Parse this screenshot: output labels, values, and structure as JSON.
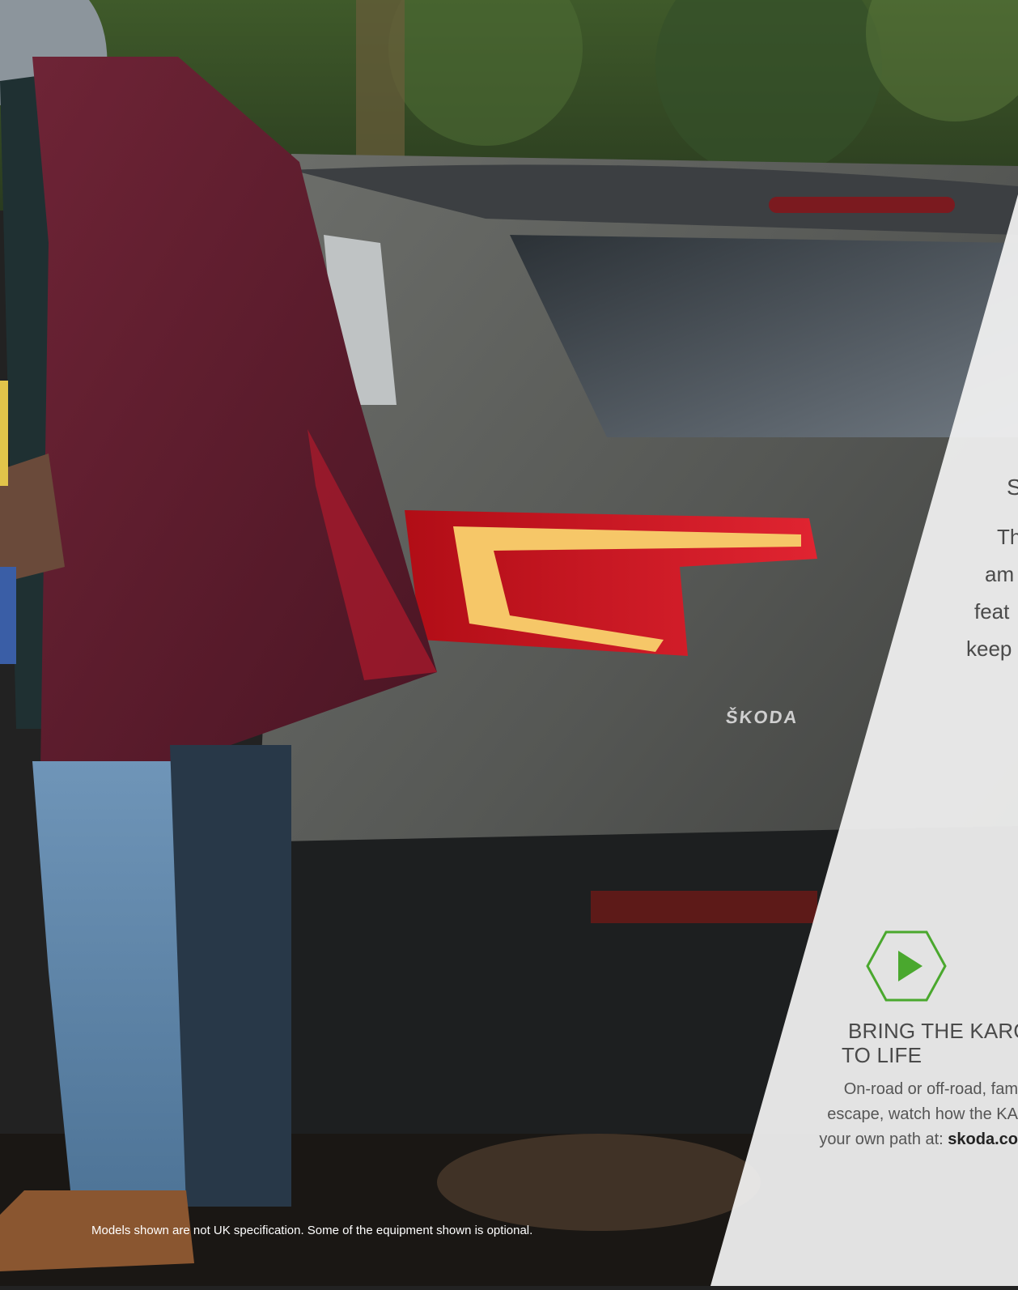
{
  "badge": {
    "brand": "ŠKODA"
  },
  "side_panel": {
    "heading_fragment": "S",
    "body_fragments": [
      "Th",
      "am",
      "feat",
      "keep"
    ],
    "headline_line1": "BRING THE KARO",
    "headline_line2": "TO LIFE",
    "promo_line1": "On-road or off-road, fam",
    "promo_line2": "escape, watch how the KA",
    "promo_line3_prefix": "your own path at: ",
    "promo_line3_link": "skoda.co"
  },
  "footer": {
    "disclaimer": "Models shown are not UK specification. Some of the equipment shown is optional."
  },
  "colors": {
    "accent_green": "#4aa82e",
    "panel_white": "#f2f2f2",
    "text_grey": "#4a4a4a"
  },
  "icons": {
    "play": "play-hexagon-icon"
  }
}
